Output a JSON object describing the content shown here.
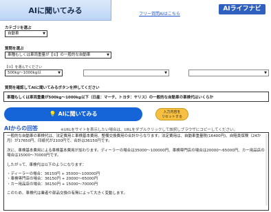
{
  "header": {
    "title": "AIに聞いてみる",
    "free_link": "フリー質問AIはこちら",
    "logo": "AIライフナビ"
  },
  "category": {
    "label": "カテゴリを選ぶ",
    "selected": "自動車"
  },
  "question": {
    "label": "質問を選ぶ",
    "selected": "車種もしくは車両重量が【①】の一般的な自動車"
  },
  "params": {
    "hint": "【①】を選んでください",
    "select1": "500kg〜1000kg以",
    "select2": "",
    "select3": ""
  },
  "confirm": {
    "label": "質問を確認してAIに聞いてみるボタンを押してください",
    "text": "車種もしくは車両重量が500kg〜1000kg以下（日産：マーチ、トヨタ：ヤリス）の一般的な自動車の車検代はいくらか"
  },
  "buttons": {
    "ask": "AIに聞いてみる",
    "reset_line1": "入力内容を",
    "reset_line2": "リセットする"
  },
  "answer": {
    "title": "AIからの回答",
    "note": "※URLをサイトを表示したい場合は、URLをダブルクリックして該択しブラウザにコピーしてください。",
    "lines": [
      "一般的な自動車の車検代は、法定費用と車検基本費用、整備交換費用の合計からなります。法定費用は、自動車重量税(16400円)、自賠責保険（24か月）が17650円、印紙代が2100円で、合計は36150円です。",
      "",
      "次に、車検基本費用による車検基本費用が加わります。ディーラーの場合は35000〜100000円、車検専門店の場合は20000〜65000円、カー用品店の場合は15000〜70000円です。",
      "",
      "したがって、車検代は以下のようになります：",
      "",
      "・ディーラーの場合：36150円 + 35000〜100000円",
      "・車検専門店の場合：36150円 + 20000〜65000円",
      "・カー用品店の場合：36150円 + 15000〜70000円",
      "",
      "このため、車検代は業者や部品交換の有無によって大きく変動します。"
    ]
  },
  "colors": {
    "accent": "#1565d8",
    "logo_bg": "#2f5fbf",
    "reset_bg": "#f7c040",
    "answer_title": "#1f57c4"
  }
}
